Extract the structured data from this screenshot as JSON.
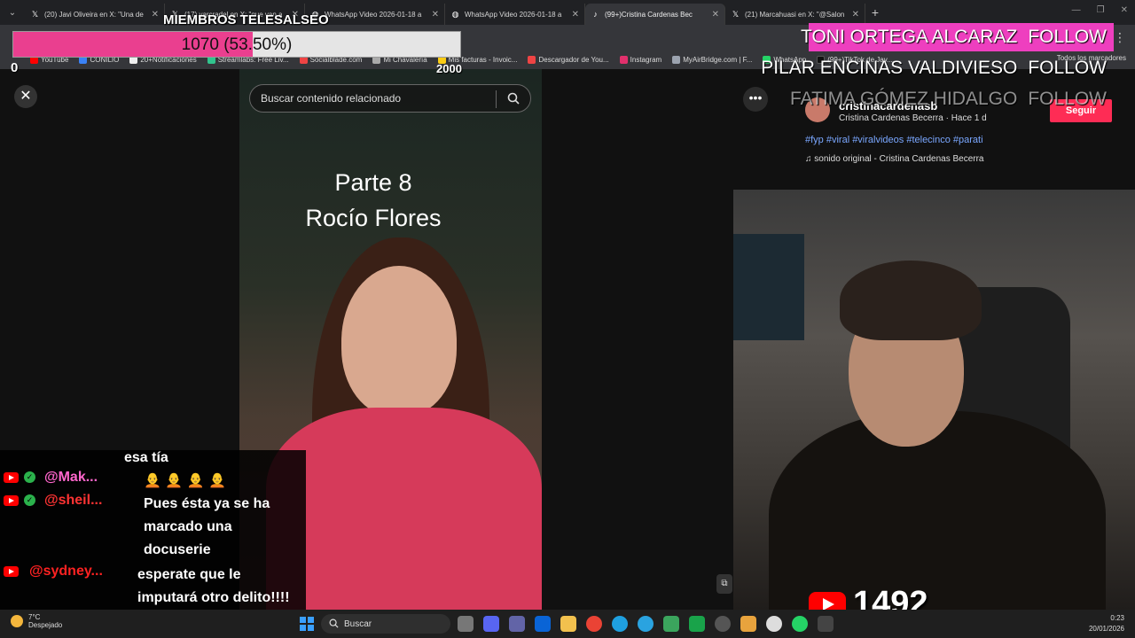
{
  "browser": {
    "tabs": [
      {
        "icon": "x-icon",
        "title": "(20) Javi Oliveira en X: \"Una de"
      },
      {
        "icon": "x-icon",
        "title": "(17) varcradel en X: \"que van a"
      },
      {
        "icon": "globe-icon",
        "title": "WhatsApp Video 2026-01-18 a"
      },
      {
        "icon": "globe-icon",
        "title": "WhatsApp Video 2026-01-18 a"
      },
      {
        "icon": "tiktok-icon",
        "title": "(99+)Cristina Cardenas Bec"
      },
      {
        "icon": "x-icon",
        "title": "(21) Marcahuasi en X: \"@Salon"
      }
    ],
    "bookmarks": [
      "YouTube",
      "CONILIO",
      "20+Notificaciones",
      "Streamlabs: Free Liv...",
      "Socialblade.com",
      "Mi Chavalería",
      "Mis facturas - Invoic...",
      "Descargador de You...",
      "Instagram",
      "MyAirBridge.com | F...",
      "WhatsApp",
      "(99+)TikTok de Jav..."
    ],
    "bookmarks_end": "Todos los marcadores"
  },
  "goal": {
    "title": "MIEMBROS TELESALSEO",
    "text": "1070 (53.50%)",
    "progress": 0.535,
    "min": "0",
    "max": "2000",
    "color": "#ea3f8f"
  },
  "followers": [
    {
      "name": "TONI ORTEGA ALCARAZ",
      "action": "FOLLOW"
    },
    {
      "name": "PILAR ENCINAS VALDIVIESO",
      "action": "FOLLOW"
    },
    {
      "name": "FATIMA GÓMEZ HIDALGO",
      "action": "FOLLOW"
    }
  ],
  "tiktok": {
    "search_placeholder": "Buscar contenido relacionado",
    "video_title_line1": "Parte 8",
    "video_title_line2": "Rocío Flores",
    "creator_handle": "cristinacardenasb",
    "creator_sub": "Cristina Cardenas Becerra · Hace 1 d",
    "follow_label": "Seguir",
    "hashtags": "#fyp #viral #viralvideos #telecinco #parati",
    "sound": "sonido original - Cristina Cardenas Becerra",
    "accent": "#fe2c55"
  },
  "chat": {
    "fragment": "esa tía",
    "messages": [
      {
        "user": "@Mak...",
        "user_color": "#ff66cc",
        "text": "🧑‍🦲 🧑‍🦲 🧑‍🦲 🧑‍🦲"
      },
      {
        "user": "@sheil...",
        "user_color": "#ff3333",
        "text": "Pues ésta ya se ha marcado una docuserie"
      },
      {
        "user": "@sydney...",
        "user_color": "#ff2222",
        "text": "esperate que le imputará otro delito!!!!"
      }
    ]
  },
  "youtube": {
    "viewers": "1492"
  },
  "taskbar": {
    "temp": "7°C",
    "weather": "Despejado",
    "search": "Buscar",
    "time": "0:23",
    "date": "20/01/2026"
  }
}
